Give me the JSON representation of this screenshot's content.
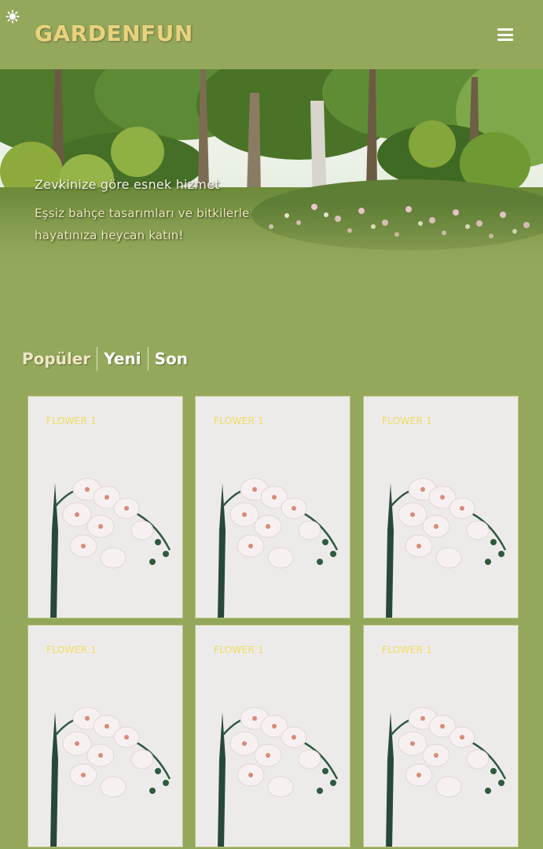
{
  "header": {
    "logo": "GARDENFUN",
    "theme_toggle_icon": "sun-icon",
    "menu_icon": "hamburger-menu-icon"
  },
  "hero": {
    "title": "Zevkinize göre esnek hizmet",
    "subtitle": "Eşsiz bahçe tasarımları ve bitkilerle hayatınıza heycan katın!"
  },
  "tabs": [
    {
      "label": "Popüler"
    },
    {
      "label": "Yeni"
    },
    {
      "label": "Son"
    }
  ],
  "cards": [
    {
      "label": "FLOWER 1"
    },
    {
      "label": "FLOWER 1"
    },
    {
      "label": "FLOWER 1"
    },
    {
      "label": "FLOWER 1"
    },
    {
      "label": "FLOWER 1"
    },
    {
      "label": "FLOWER 1"
    }
  ],
  "colors": {
    "background": "#94a85c",
    "logo": "#e9d27c",
    "card_label": "#f1dd5a"
  }
}
